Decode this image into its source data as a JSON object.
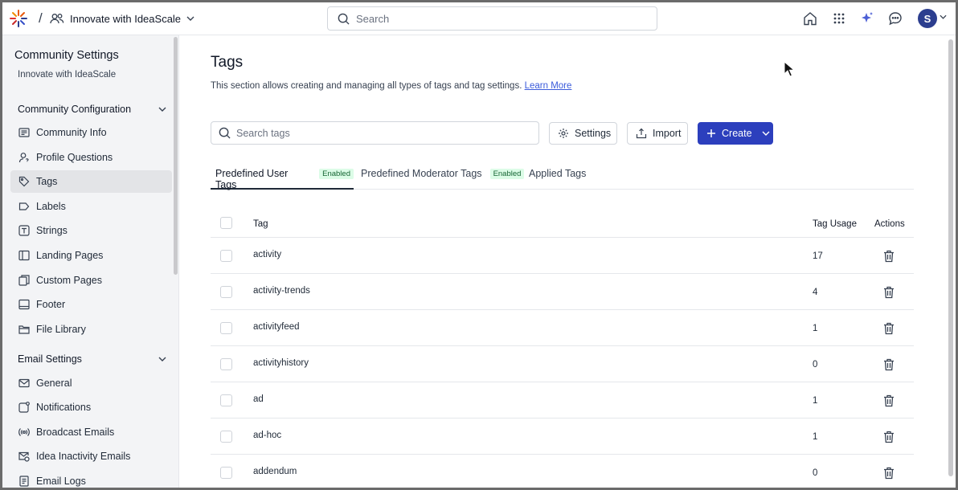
{
  "topbar": {
    "separator": "/",
    "workspace_name": "Innovate with IdeaScale",
    "search_placeholder": "Search",
    "avatar_initial": "S"
  },
  "sidebar": {
    "title": "Community Settings",
    "subtitle": "Innovate with IdeaScale",
    "groups": [
      {
        "label": "Community Configuration",
        "items": [
          {
            "label": "Community Info",
            "icon": "info-card-icon"
          },
          {
            "label": "Profile Questions",
            "icon": "user-question-icon"
          },
          {
            "label": "Tags",
            "icon": "tag-icon",
            "active": true
          },
          {
            "label": "Labels",
            "icon": "label-icon"
          },
          {
            "label": "Strings",
            "icon": "text-icon"
          },
          {
            "label": "Landing Pages",
            "icon": "layout-icon"
          },
          {
            "label": "Custom Pages",
            "icon": "pages-icon"
          },
          {
            "label": "Footer",
            "icon": "footer-icon"
          },
          {
            "label": "File Library",
            "icon": "folder-icon"
          }
        ]
      },
      {
        "label": "Email Settings",
        "items": [
          {
            "label": "General",
            "icon": "email-icon"
          },
          {
            "label": "Notifications",
            "icon": "notification-icon"
          },
          {
            "label": "Broadcast Emails",
            "icon": "broadcast-icon"
          },
          {
            "label": "Idea Inactivity Emails",
            "icon": "email-clock-icon"
          },
          {
            "label": "Email Logs",
            "icon": "log-icon"
          }
        ]
      }
    ]
  },
  "main": {
    "title": "Tags",
    "description": "This section allows creating and managing all types of tags and tag settings.",
    "learn_more": "Learn More",
    "search_placeholder": "Search tags",
    "buttons": {
      "settings": "Settings",
      "import": "Import",
      "create": "Create"
    },
    "tabs": [
      {
        "label": "Predefined User Tags",
        "badge": "Enabled",
        "active": true
      },
      {
        "label": "Predefined Moderator Tags",
        "badge": "Enabled"
      },
      {
        "label": "Applied Tags"
      }
    ],
    "table": {
      "columns": {
        "tag": "Tag",
        "usage": "Tag Usage",
        "actions": "Actions"
      },
      "rows": [
        {
          "tag": "activity",
          "usage": "17"
        },
        {
          "tag": "activity-trends",
          "usage": "4"
        },
        {
          "tag": "activityfeed",
          "usage": "1"
        },
        {
          "tag": "activityhistory",
          "usage": "0"
        },
        {
          "tag": "ad",
          "usage": "1"
        },
        {
          "tag": "ad-hoc",
          "usage": "1"
        },
        {
          "tag": "addendum",
          "usage": "0"
        }
      ]
    }
  }
}
